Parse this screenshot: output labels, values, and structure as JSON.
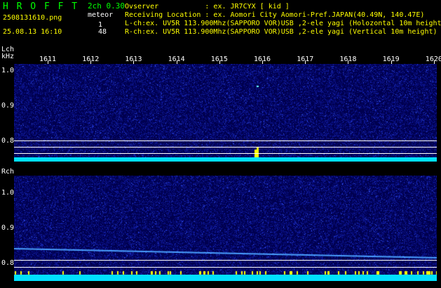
{
  "header": {
    "app_name": "H R O F F T",
    "version": "2ch 0.30",
    "file_name": "2508131610.png",
    "datetime": "25.08.13 16:10",
    "meteor_label": "meteor",
    "meteor_count_lch": "1",
    "meteor_count_rch": "48",
    "info_lines": [
      "Ovserver           : ex. JR7CYX [ kid ]",
      "Receiving Location : ex. Aomori City Aomori-Pref.JAPAN(40.49N, 140.47E)",
      "L-ch:ex. UV5R 113.900Mhz(SAPPORO VOR)USB ,2-ele yagi (Holozontal 10m height)",
      "R-ch:ex. UV5R 113.900Mhz(SAPPORO VOR)USB ,2-ele yagi (Vertical 10m height)"
    ]
  },
  "lch": {
    "label": "Lch",
    "unit": "kHz",
    "y_ticks": [
      "1.0",
      "0.9",
      "0.8"
    ]
  },
  "rch": {
    "label": "Rch",
    "y_ticks": [
      "1.0",
      "0.9",
      "0.8"
    ]
  },
  "time_ticks": [
    "1611",
    "1612",
    "1613",
    "1614",
    "1615",
    "1616",
    "1617",
    "1618",
    "1619",
    "1620"
  ],
  "colors": {
    "background": "#000000",
    "panel_noise": "#00006a",
    "baseline": "#00e0ff",
    "meteor_echo": "#ffff00",
    "header_green": "#00ff00",
    "header_yellow": "#ffff00"
  }
}
